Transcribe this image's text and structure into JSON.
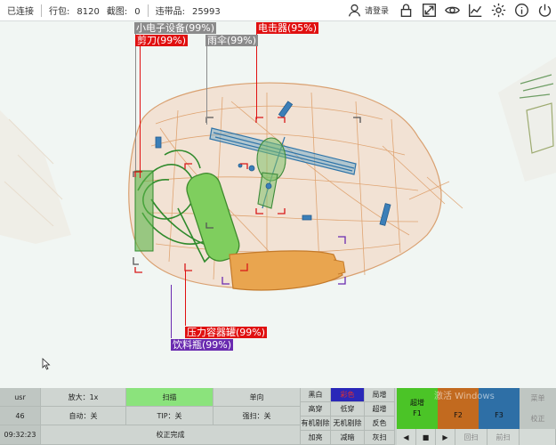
{
  "topbar": {
    "connection": "已连接",
    "lines_label": "行包:",
    "lines_value": "8120",
    "captures_label": "截图:",
    "captures_value": "0",
    "contraband_label": "违带品:",
    "contraband_value": "25993",
    "login_label": "请登录",
    "icons": [
      "user-icon",
      "lock-icon",
      "fullscreen-icon",
      "eye-icon",
      "chart-icon",
      "gear-icon",
      "info-icon",
      "power-icon"
    ]
  },
  "detections": [
    {
      "label": "小电子设备(99%)",
      "color": "#8b8b8b"
    },
    {
      "label": "剪刀(99%)",
      "color": "#e01010"
    },
    {
      "label": "雨伞(99%)",
      "color": "#8b8b8b"
    },
    {
      "label": "电击器(95%)",
      "color": "#e01010"
    },
    {
      "label": "压力容器罐(99%)",
      "color": "#e01010"
    },
    {
      "label": "饮料瓶(99%)",
      "color": "#6a2bb0"
    }
  ],
  "panel": {
    "user": "usr",
    "user_id": "46",
    "time": "09:32:23",
    "zoom": "放大：1x",
    "auto": "自动：关",
    "scan": "扫描",
    "tip": "TIP：关",
    "calibrate": "校正完成",
    "direction": "单向",
    "force_scan": "强扫：关",
    "modes": [
      [
        "黑白",
        "彩色",
        "局增"
      ],
      [
        "高穿",
        "低穿",
        "超增"
      ],
      [
        "有机剔除",
        "无机剔除",
        "反色"
      ],
      [
        "加亮",
        "减暗",
        "灰扫"
      ]
    ],
    "f1_title": "超增",
    "f1_key": "F1",
    "f2_key": "F2",
    "f3_key": "F3",
    "menu": "菜单",
    "correct": "校正",
    "back_scan": "回扫",
    "forward_scan": "前扫",
    "watermark": "激活 Windows"
  }
}
